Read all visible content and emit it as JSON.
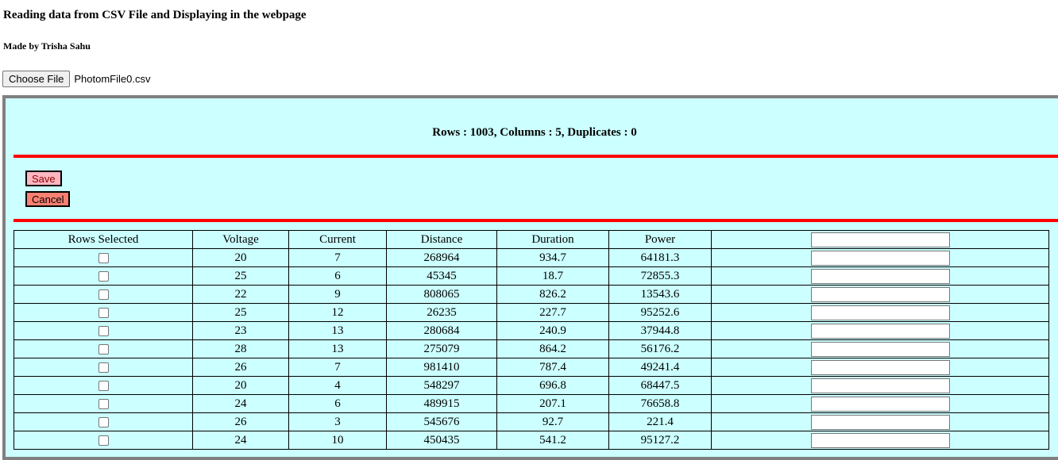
{
  "page": {
    "title": "Reading data from CSV File and Displaying in the webpage",
    "subtitle": "Made by Trisha Sahu"
  },
  "file_input": {
    "button_label": "Choose File",
    "file_name": "PhotomFile0.csv"
  },
  "summary": "Rows : 1003, Columns : 5, Duplicates : 0",
  "actions": {
    "save_label": "Save",
    "cancel_label": "Cancel"
  },
  "table": {
    "headers": [
      "Rows Selected",
      "Voltage",
      "Current",
      "Distance",
      "Duration",
      "Power"
    ],
    "rows": [
      [
        "20",
        "7",
        "268964",
        "934.7",
        "64181.3"
      ],
      [
        "25",
        "6",
        "45345",
        "18.7",
        "72855.3"
      ],
      [
        "22",
        "9",
        "808065",
        "826.2",
        "13543.6"
      ],
      [
        "25",
        "12",
        "26235",
        "227.7",
        "95252.6"
      ],
      [
        "23",
        "13",
        "280684",
        "240.9",
        "37944.8"
      ],
      [
        "28",
        "13",
        "275079",
        "864.2",
        "56176.2"
      ],
      [
        "26",
        "7",
        "981410",
        "787.4",
        "49241.4"
      ],
      [
        "20",
        "4",
        "548297",
        "696.8",
        "68447.5"
      ],
      [
        "24",
        "6",
        "489915",
        "207.1",
        "76658.8"
      ],
      [
        "26",
        "3",
        "545676",
        "92.7",
        "221.4"
      ],
      [
        "24",
        "10",
        "450435",
        "541.2",
        "95127.2"
      ]
    ]
  },
  "colors": {
    "panel_background": "#ccffff",
    "divider": "#ff0000",
    "save_button": "#ffb6c1",
    "cancel_button": "#fa8072"
  }
}
